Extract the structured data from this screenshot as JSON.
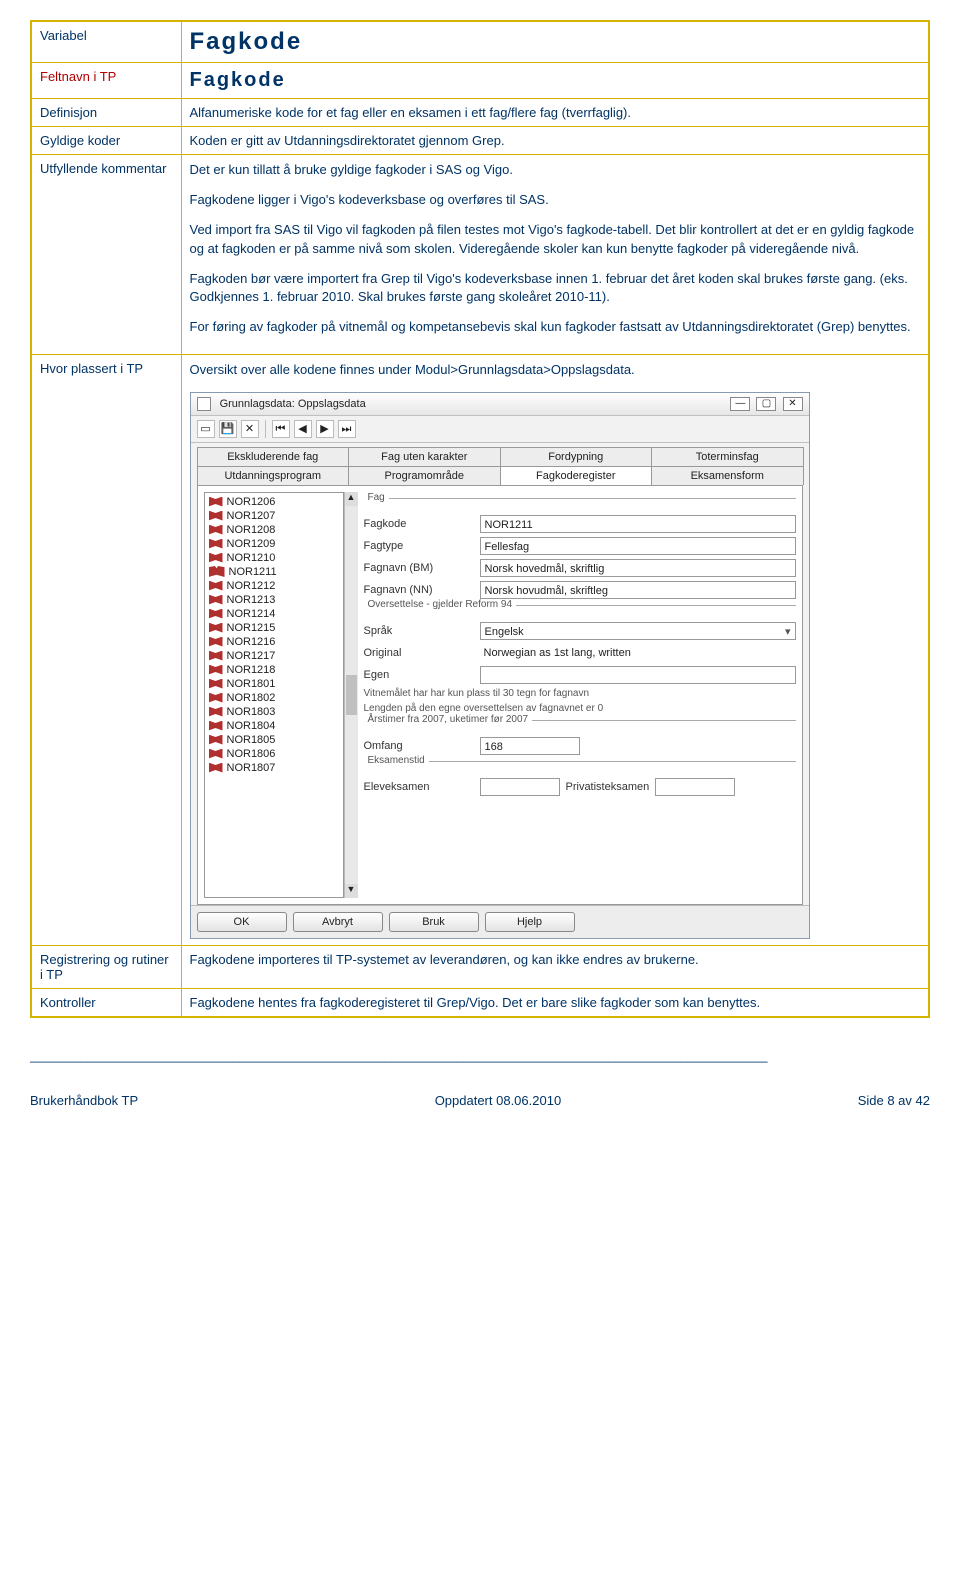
{
  "rows": {
    "variabel": {
      "label": "Variabel",
      "value": "Fagkode"
    },
    "feltnavn": {
      "label": "Feltnavn i TP",
      "value": "Fagkode"
    },
    "definisjon": {
      "label": "Definisjon",
      "value": "Alfanumeriske kode for et fag eller en eksamen i ett fag/flere fag (tverrfaglig)."
    },
    "gyldige": {
      "label": "Gyldige koder",
      "value": "Koden er gitt av Utdanningsdirektoratet gjennom Grep."
    },
    "utfyllende": {
      "label": "Utfyllende kommentar",
      "p1": "Det er kun tillatt å bruke gyldige fagkoder i SAS og Vigo.",
      "p2": "Fagkodene ligger i Vigo's kodeverksbase og overføres til SAS.",
      "p3": "Ved import fra SAS til Vigo vil fagkoden på filen testes mot Vigo's fagkode-tabell. Det blir kontrollert at det er en gyldig fagkode og at fagkoden er på samme nivå som skolen. Videregående skoler kan kun benytte fagkoder på videregående nivå.",
      "p4": "Fagkoden bør være importert fra Grep til Vigo's kodeverksbase innen 1. februar det året koden skal brukes første gang. (eks. Godkjennes 1. februar 2010. Skal brukes første gang skoleåret 2010-11).",
      "p5": "For føring av fagkoder på vitnemål og kompetansebevis skal kun fagkoder fastsatt av Utdanningsdirektoratet (Grep) benyttes."
    },
    "hvorplassert": {
      "label": "Hvor plassert i TP",
      "intro": "Oversikt over alle kodene finnes under Modul>Grunnlagsdata>Oppslagsdata."
    },
    "registrering": {
      "label": "Registrering og rutiner i TP",
      "value": "Fagkodene importeres til TP-systemet av leverandøren, og kan ikke endres av brukerne."
    },
    "kontroller": {
      "label": "Kontroller",
      "value": "Fagkodene hentes fra fagkoderegisteret til Grep/Vigo. Det er bare slike fagkoder som kan benyttes."
    }
  },
  "app": {
    "title": "Grunnlagsdata: Oppslagsdata",
    "tabs_top": [
      "Ekskluderende fag",
      "Fag uten karakter",
      "Fordypning",
      "Toterminsfag"
    ],
    "tabs_bot": [
      "Utdanningsprogram",
      "Programområde",
      "Fagkoderegister",
      "Eksamensform"
    ],
    "active_tab": "Fagkoderegister",
    "list": [
      "NOR1206",
      "NOR1207",
      "NOR1208",
      "NOR1209",
      "NOR1210",
      "NOR1211",
      "NOR1212",
      "NOR1213",
      "NOR1214",
      "NOR1215",
      "NOR1216",
      "NOR1217",
      "NOR1218",
      "NOR1801",
      "NOR1802",
      "NOR1803",
      "NOR1804",
      "NOR1805",
      "NOR1806",
      "NOR1807"
    ],
    "selected": "NOR1211",
    "form": {
      "fag_label": "Fag",
      "fagkode_label": "Fagkode",
      "fagkode": "NOR1211",
      "fagtype_label": "Fagtype",
      "fagtype": "Fellesfag",
      "fagnavn_bm_label": "Fagnavn (BM)",
      "fagnavn_bm": "Norsk hovedmål, skriftlig",
      "fagnavn_nn_label": "Fagnavn (NN)",
      "fagnavn_nn": "Norsk hovudmål, skriftleg",
      "oversettelse_header": "Oversettelse - gjelder Reform 94",
      "sprak_label": "Språk",
      "sprak": "Engelsk",
      "original_label": "Original",
      "original": "Norwegian as 1st lang, written",
      "egen_label": "Egen",
      "note1": "Vitnemålet har har kun plass til 30 tegn for fagnavn",
      "note2": "Lengden på den egne oversettelsen av fagnavnet er 0",
      "arstimer_label": "Årstimer fra 2007, uketimer før 2007",
      "omfang_label": "Omfang",
      "omfang": "168",
      "eksamenstid_label": "Eksamenstid",
      "eleveksamen_label": "Eleveksamen",
      "privatisteksamen_label": "Privatisteksamen"
    },
    "buttons": {
      "ok": "OK",
      "avbryt": "Avbryt",
      "bruk": "Bruk",
      "hjelp": "Hjelp"
    }
  },
  "footer": {
    "left": "Brukerhåndbok TP",
    "mid": "Oppdatert  08.06.2010",
    "right": "Side 8 av 42"
  }
}
